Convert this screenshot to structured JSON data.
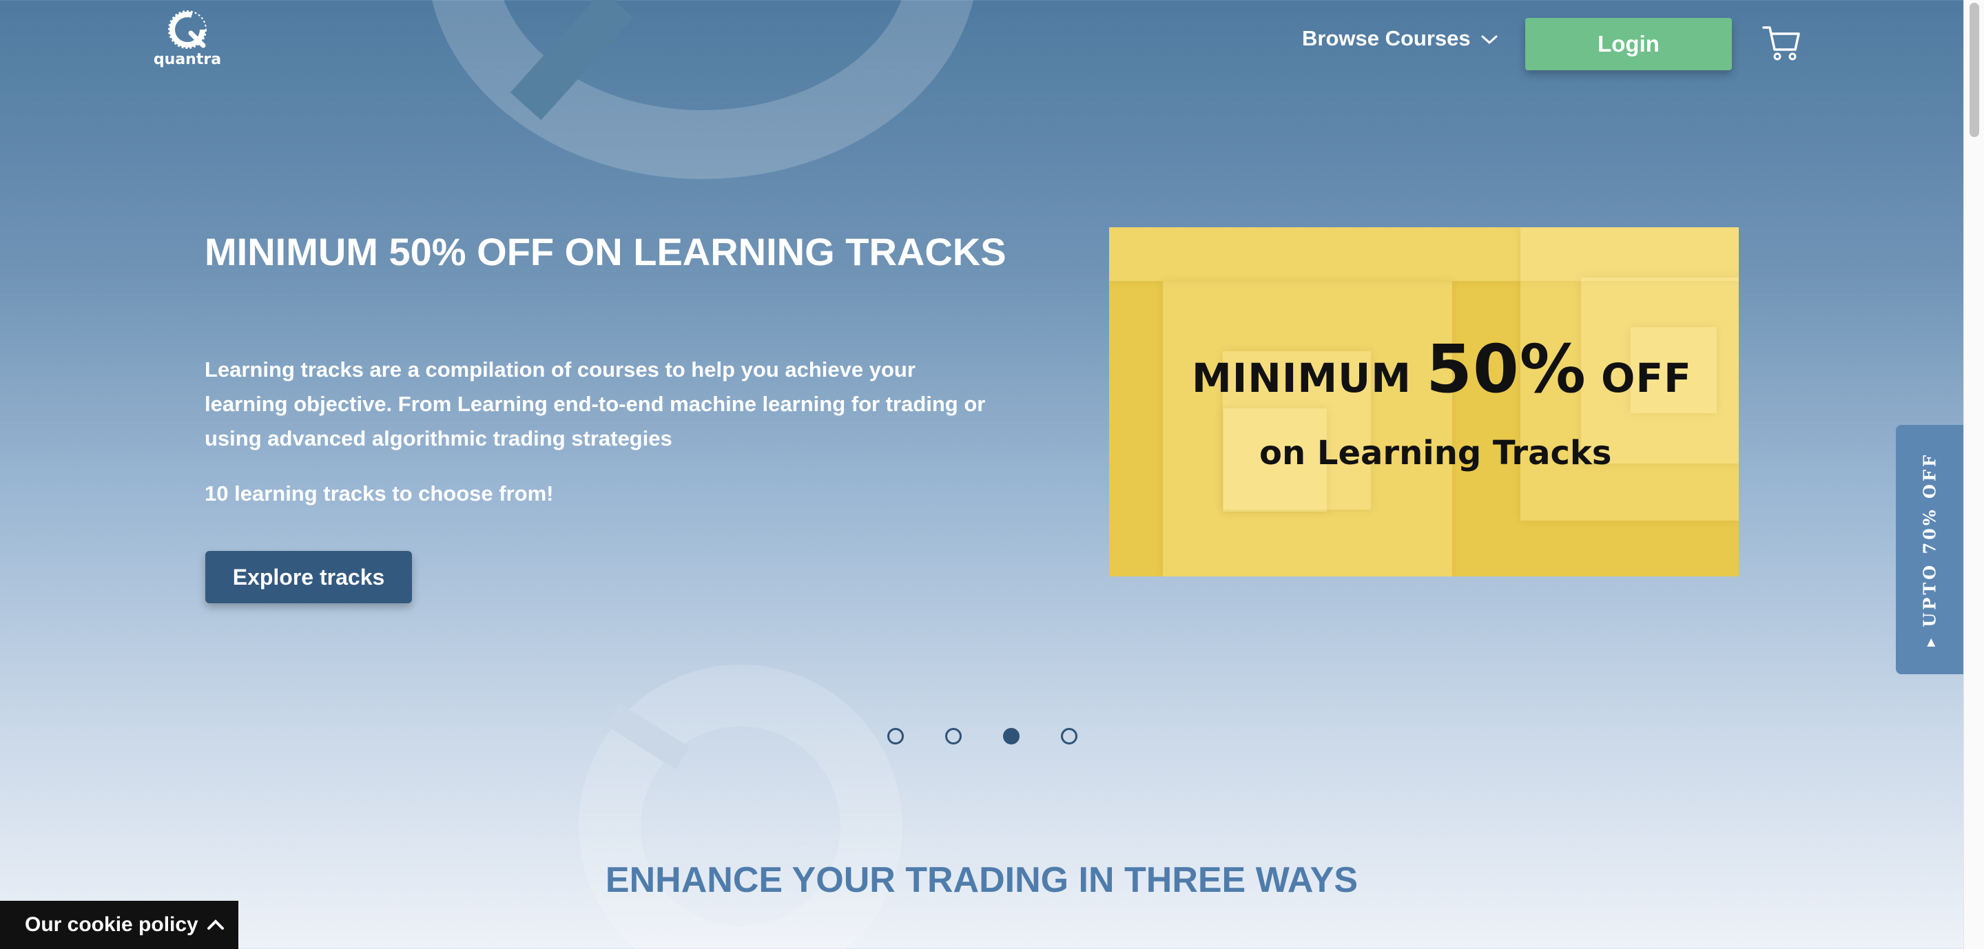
{
  "header": {
    "logo_text": "quantra",
    "browse_label": "Browse Courses",
    "login_label": "Login"
  },
  "hero": {
    "title": "MINIMUM 50% OFF ON LEARNING TRACKS",
    "description": "Learning tracks are a compilation of courses to help you achieve your learning objective. From Learning end-to-end machine learning for trading or using advanced algorithmic trading strategies",
    "count_text": "10 learning tracks to choose from!",
    "cta_label": "Explore tracks",
    "banner": {
      "line1_prefix": "MINIMUM",
      "line1_big": "50%",
      "line1_suffix": "OFF",
      "line2": "on Learning Tracks"
    }
  },
  "carousel": {
    "slide_count": 4,
    "active_index": 3
  },
  "side_tab": {
    "label": "UPTO 70% OFF"
  },
  "section": {
    "title": "ENHANCE YOUR TRADING IN THREE WAYS"
  },
  "cookie": {
    "label": "Our cookie policy"
  },
  "icons": {
    "browse_chevron": "chevron-down-icon",
    "cart": "cart-icon",
    "cookie_chevron": "chevron-up-icon",
    "side_tab_arrow": "triangle-icon"
  },
  "colors": {
    "login": "#6fc08a",
    "cta": "#34597f",
    "banner": "#e9c94b",
    "side_tab": "#5d87b3",
    "section_title": "#4f7cab"
  }
}
